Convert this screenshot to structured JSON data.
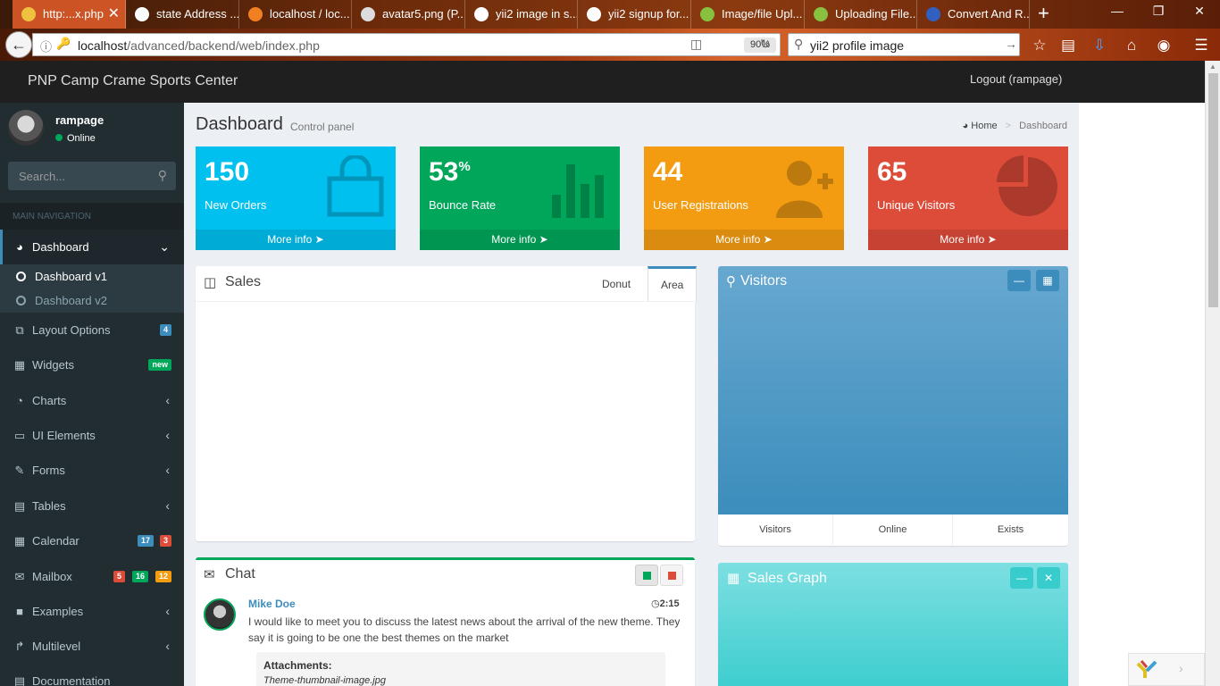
{
  "browser": {
    "tabs": [
      {
        "title": "http:...x.php",
        "active": true
      },
      {
        "title": "state Address ..."
      },
      {
        "title": "localhost / loc..."
      },
      {
        "title": "avatar5.png (P..."
      },
      {
        "title": "yii2 image in s..."
      },
      {
        "title": "yii2 signup for..."
      },
      {
        "title": "Image/file Upl..."
      },
      {
        "title": "Uploading File..."
      },
      {
        "title": "Convert And R..."
      }
    ],
    "url_host": "localhost",
    "url_path": "/advanced/backend/web/index.php",
    "zoom": "90%",
    "search_query": "yii2 profile image"
  },
  "header": {
    "brand": "PNP Camp Crame Sports Center",
    "logout": "Logout (rampage)"
  },
  "sidebar": {
    "user_name": "rampage",
    "user_status": "Online",
    "search_placeholder": "Search...",
    "nav_header": "MAIN NAVIGATION",
    "dashboard": {
      "label": "Dashboard",
      "sub": [
        "Dashboard v1",
        "Dashboard v2"
      ]
    },
    "items": [
      {
        "label": "Layout Options",
        "badges": [
          {
            "text": "4",
            "color": "#3c8dbc"
          }
        ]
      },
      {
        "label": "Widgets",
        "badges": [
          {
            "text": "new",
            "color": "#00a65a"
          }
        ]
      },
      {
        "label": "Charts"
      },
      {
        "label": "UI Elements"
      },
      {
        "label": "Forms"
      },
      {
        "label": "Tables"
      },
      {
        "label": "Calendar",
        "badges": [
          {
            "text": "17",
            "color": "#3c8dbc"
          },
          {
            "text": "3",
            "color": "#dd4b39"
          }
        ]
      },
      {
        "label": "Mailbox",
        "badges": [
          {
            "text": "5",
            "color": "#dd4b39"
          },
          {
            "text": "16",
            "color": "#00a65a"
          },
          {
            "text": "12",
            "color": "#f39c12"
          }
        ]
      },
      {
        "label": "Examples"
      },
      {
        "label": "Multilevel"
      },
      {
        "label": "Documentation"
      }
    ]
  },
  "content": {
    "title": "Dashboard",
    "subtitle": "Control panel",
    "breadcrumb": {
      "home": "Home",
      "current": "Dashboard"
    },
    "smallboxes": [
      {
        "value": "150",
        "label": "New Orders",
        "more": "More info",
        "color": "#00c0ef"
      },
      {
        "value": "53",
        "suffix": "%",
        "label": "Bounce Rate",
        "more": "More info",
        "color": "#00a65a"
      },
      {
        "value": "44",
        "label": "User Registrations",
        "more": "More info",
        "color": "#f39c12"
      },
      {
        "value": "65",
        "label": "Unique Visitors",
        "more": "More info",
        "color": "#dd4b39"
      }
    ],
    "sales": {
      "title": "Sales",
      "tabs": [
        "Donut",
        "Area"
      ],
      "active_tab": "Area"
    },
    "visitors": {
      "title": "Visitors",
      "footer": [
        "Visitors",
        "Online",
        "Exists"
      ]
    },
    "chat": {
      "title": "Chat",
      "message": {
        "author": "Mike Doe",
        "time": "2:15",
        "text": "I would like to meet you to discuss the latest news about the arrival of the new theme. They say it is going to be one the best themes on the market",
        "attachments_label": "Attachments:",
        "attachment": "Theme-thumbnail-image.jpg"
      }
    },
    "sales_graph": {
      "title": "Sales Graph"
    }
  }
}
